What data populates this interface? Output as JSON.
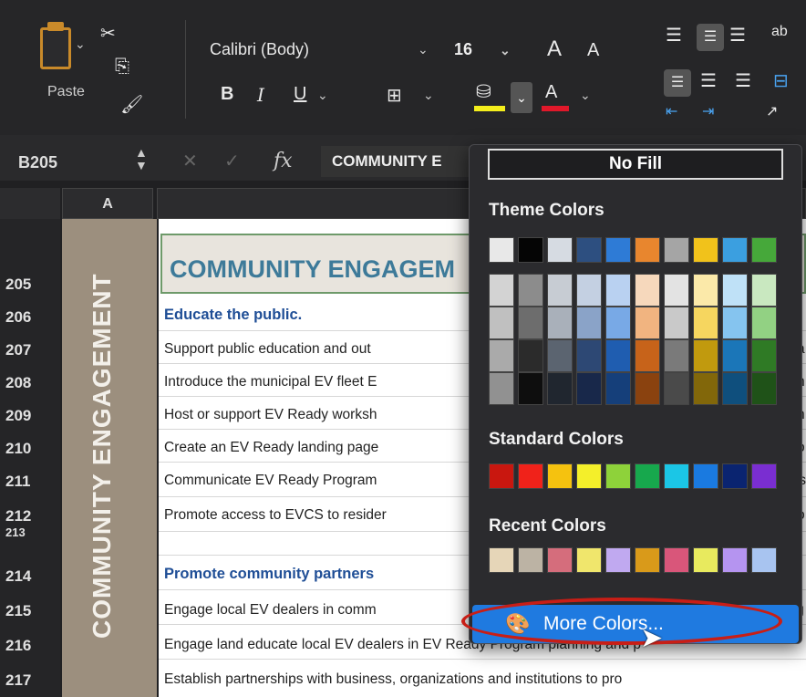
{
  "ribbon": {
    "paste_label": "Paste",
    "font_name": "Calibri (Body)",
    "font_size": "16",
    "bold": "B",
    "italic": "I",
    "underline": "U",
    "grow": "A",
    "shrink": "A",
    "font_color": "A"
  },
  "formula_bar": {
    "cell_ref": "B205",
    "fx": "fx",
    "value": "COMMUNITY E"
  },
  "sheet": {
    "column_a": "A",
    "side_label": "COMMUNITY ENGAGEMENT",
    "header_205": "COMMUNITY ENGAGEM",
    "rows": [
      {
        "num": "205",
        "text": ""
      },
      {
        "num": "206",
        "text": "Educate the public."
      },
      {
        "num": "207",
        "text": "Support public education and out"
      },
      {
        "num": "208",
        "text": "Introduce the municipal EV fleet E"
      },
      {
        "num": "209",
        "text": "Host or support EV Ready worksh"
      },
      {
        "num": "210",
        "text": "Create an EV Ready landing page"
      },
      {
        "num": "211",
        "text": "Communicate EV Ready Program"
      },
      {
        "num": "212",
        "text": "Promote access to EVCS to resider"
      },
      {
        "num": "213",
        "text": ""
      },
      {
        "num": "214",
        "text": "Promote community partners"
      },
      {
        "num": "215",
        "text": "Engage local EV dealers in comm"
      },
      {
        "num": "216",
        "text": "Engage land educate local EV dealers in EV Ready Program planning and p"
      },
      {
        "num": "217",
        "text": "Establish partnerships with business, organizations and institutions to pro"
      }
    ],
    "right_edge": [
      "a",
      "h",
      "n",
      "o",
      "ts",
      "o",
      "rg"
    ]
  },
  "fill_menu": {
    "no_fill": "No Fill",
    "theme_label": "Theme Colors",
    "standard_label": "Standard Colors",
    "recent_label": "Recent Colors",
    "more_colors": "More Colors...",
    "theme_top": [
      "#e8e8e8",
      "#050505",
      "#d6dbe2",
      "#2d4f80",
      "#2e7bd6",
      "#e8862e",
      "#a5a5a5",
      "#f1c21b",
      "#3b9fe0",
      "#46a83a"
    ],
    "theme_shades": [
      [
        "#d3d3d3",
        "#c0c0c0",
        "#aaaaaa",
        "#919191"
      ],
      [
        "#8c8c8c",
        "#6d6d6d",
        "#2b2b2b",
        "#0e0e0e"
      ],
      [
        "#c7ccd3",
        "#a9b0ba",
        "#5b6470",
        "#20262f"
      ],
      [
        "#c4d0e2",
        "#8aa3c8",
        "#2d4874",
        "#18284a"
      ],
      [
        "#b9d1f1",
        "#78a9e6",
        "#1f5db0",
        "#153f7a"
      ],
      [
        "#f6d8bc",
        "#f1b480",
        "#c7631a",
        "#8a420f"
      ],
      [
        "#e3e3e3",
        "#c9c9c9",
        "#7a7a7a",
        "#4a4a4a"
      ],
      [
        "#fbe9a9",
        "#f6d65f",
        "#c19a0e",
        "#82670a"
      ],
      [
        "#bfe1f7",
        "#85c4ef",
        "#1b76b8",
        "#0f4f7d"
      ],
      [
        "#c9e8c0",
        "#92d183",
        "#2f7a25",
        "#1f5218"
      ]
    ],
    "standard": [
      "#c9170f",
      "#f0221a",
      "#f5c20f",
      "#f4ef2a",
      "#8ed23a",
      "#17a84d",
      "#1bc6e6",
      "#1a7ae0",
      "#0a2470",
      "#7a2ed1"
    ],
    "recent": [
      "#e6d6b8",
      "#bcb3a4",
      "#d56d7c",
      "#f0e66c",
      "#c0a9f0",
      "#d99a1a",
      "#d9567a",
      "#e8ea5e",
      "#b594f0",
      "#a8c4f0"
    ]
  }
}
